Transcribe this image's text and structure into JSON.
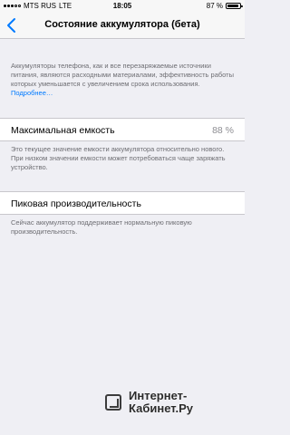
{
  "status_bar": {
    "carrier": "MTS RUS",
    "network": "LTE",
    "time": "18:05",
    "battery_percent": "87 %",
    "battery_level": 0.87
  },
  "nav": {
    "back_icon": "chevron-left-icon",
    "title": "Состояние аккумулятора (бета)"
  },
  "intro": {
    "text": "Аккумуляторы телефона, как и все перезаряжаемые источники питания, являются расходными материалами, эффективность работы которых уменьшается с увеличением срока использования.",
    "link": "Подробнее…"
  },
  "max_capacity": {
    "label": "Максимальная емкость",
    "value": "88 %",
    "description": "Это текущее значение емкости аккумулятора относительно нового. При низком значении емкости может потребоваться чаще заряжать устройство."
  },
  "peak_performance": {
    "label": "Пиковая производительность",
    "description": "Сейчас аккумулятор поддерживает нормальную пиковую производительность."
  },
  "watermark": {
    "line1": "Интернет-",
    "line2": "Кабинет.Ру"
  },
  "colors": {
    "background": "#efeff4",
    "accent": "#007aff",
    "secondary_text": "#6d6d72"
  }
}
